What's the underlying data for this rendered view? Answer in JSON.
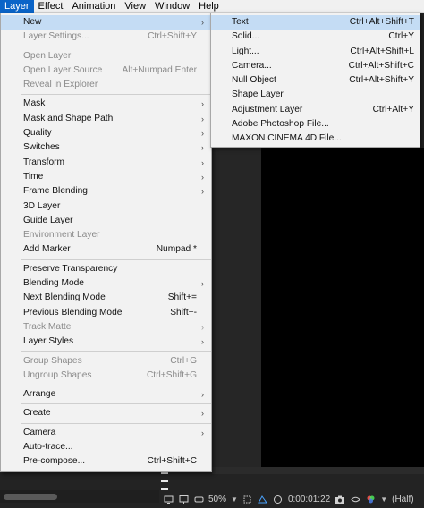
{
  "menubar": {
    "items": [
      "Layer",
      "Effect",
      "Animation",
      "View",
      "Window",
      "Help"
    ]
  },
  "layer_menu": {
    "groups": [
      [
        {
          "label": "New",
          "shortcut": "",
          "arrow": true,
          "disabled": false,
          "highlight": true
        },
        {
          "label": "Layer Settings...",
          "shortcut": "Ctrl+Shift+Y",
          "arrow": false,
          "disabled": true
        }
      ],
      [
        {
          "label": "Open Layer",
          "shortcut": "",
          "arrow": false,
          "disabled": true
        },
        {
          "label": "Open Layer Source",
          "shortcut": "Alt+Numpad Enter",
          "arrow": false,
          "disabled": true
        },
        {
          "label": "Reveal in Explorer",
          "shortcut": "",
          "arrow": false,
          "disabled": true
        }
      ],
      [
        {
          "label": "Mask",
          "shortcut": "",
          "arrow": true,
          "disabled": false
        },
        {
          "label": "Mask and Shape Path",
          "shortcut": "",
          "arrow": true,
          "disabled": false
        },
        {
          "label": "Quality",
          "shortcut": "",
          "arrow": true,
          "disabled": false
        },
        {
          "label": "Switches",
          "shortcut": "",
          "arrow": true,
          "disabled": false
        },
        {
          "label": "Transform",
          "shortcut": "",
          "arrow": true,
          "disabled": false
        },
        {
          "label": "Time",
          "shortcut": "",
          "arrow": true,
          "disabled": false
        },
        {
          "label": "Frame Blending",
          "shortcut": "",
          "arrow": true,
          "disabled": false
        },
        {
          "label": "3D Layer",
          "shortcut": "",
          "arrow": false,
          "disabled": false
        },
        {
          "label": "Guide Layer",
          "shortcut": "",
          "arrow": false,
          "disabled": false
        },
        {
          "label": "Environment Layer",
          "shortcut": "",
          "arrow": false,
          "disabled": true
        },
        {
          "label": "Add Marker",
          "shortcut": "Numpad *",
          "arrow": false,
          "disabled": false
        }
      ],
      [
        {
          "label": "Preserve Transparency",
          "shortcut": "",
          "arrow": false,
          "disabled": false
        },
        {
          "label": "Blending Mode",
          "shortcut": "",
          "arrow": true,
          "disabled": false
        },
        {
          "label": "Next Blending Mode",
          "shortcut": "Shift+=",
          "arrow": false,
          "disabled": false
        },
        {
          "label": "Previous Blending Mode",
          "shortcut": "Shift+-",
          "arrow": false,
          "disabled": false
        },
        {
          "label": "Track Matte",
          "shortcut": "",
          "arrow": true,
          "disabled": true
        },
        {
          "label": "Layer Styles",
          "shortcut": "",
          "arrow": true,
          "disabled": false
        }
      ],
      [
        {
          "label": "Group Shapes",
          "shortcut": "Ctrl+G",
          "arrow": false,
          "disabled": true
        },
        {
          "label": "Ungroup Shapes",
          "shortcut": "Ctrl+Shift+G",
          "arrow": false,
          "disabled": true
        }
      ],
      [
        {
          "label": "Arrange",
          "shortcut": "",
          "arrow": true,
          "disabled": false
        }
      ],
      [
        {
          "label": "Create",
          "shortcut": "",
          "arrow": true,
          "disabled": false
        }
      ],
      [
        {
          "label": "Camera",
          "shortcut": "",
          "arrow": true,
          "disabled": false
        },
        {
          "label": "Auto-trace...",
          "shortcut": "",
          "arrow": false,
          "disabled": false
        },
        {
          "label": "Pre-compose...",
          "shortcut": "Ctrl+Shift+C",
          "arrow": false,
          "disabled": false
        }
      ]
    ]
  },
  "new_submenu": {
    "items": [
      {
        "label": "Text",
        "shortcut": "Ctrl+Alt+Shift+T",
        "highlight": true
      },
      {
        "label": "Solid...",
        "shortcut": "Ctrl+Y"
      },
      {
        "label": "Light...",
        "shortcut": "Ctrl+Alt+Shift+L"
      },
      {
        "label": "Camera...",
        "shortcut": "Ctrl+Alt+Shift+C"
      },
      {
        "label": "Null Object",
        "shortcut": "Ctrl+Alt+Shift+Y"
      },
      {
        "label": "Shape Layer",
        "shortcut": ""
      },
      {
        "label": "Adjustment Layer",
        "shortcut": "Ctrl+Alt+Y"
      },
      {
        "label": "Adobe Photoshop File...",
        "shortcut": ""
      },
      {
        "label": "MAXON CINEMA 4D File...",
        "shortcut": ""
      }
    ]
  },
  "viewer_footer": {
    "zoom": "50%",
    "timecode": "0:00:01:22",
    "resolution": "(Half)"
  },
  "colors": {
    "highlight": "#c4dcf4",
    "menubar_active": "#0a64c8",
    "menu_bg": "#f2f2f2",
    "viewer_bg": "#000000"
  }
}
